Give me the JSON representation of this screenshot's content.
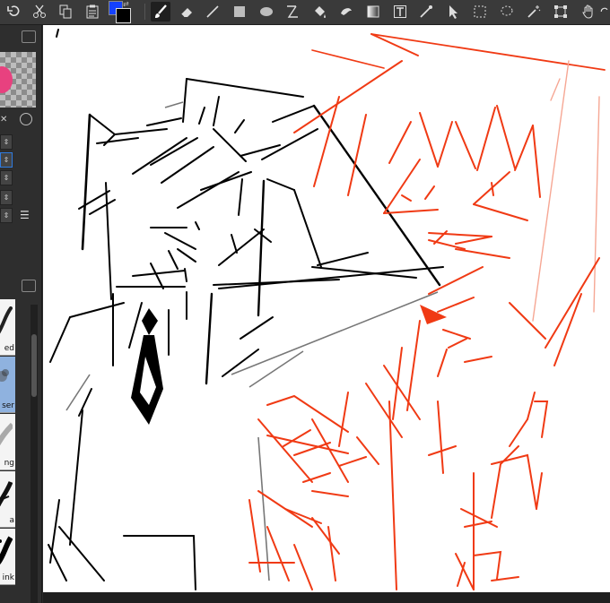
{
  "toolbar": {
    "tools": [
      {
        "id": "undo",
        "icon": "undo-icon"
      },
      {
        "id": "cut",
        "icon": "cut-icon"
      },
      {
        "id": "copy",
        "icon": "copy-icon"
      },
      {
        "id": "paste",
        "icon": "paste-icon"
      },
      {
        "id": "colors",
        "icon": "color-chips-icon",
        "foreground": "#1441ff",
        "background": "#000000"
      },
      {
        "id": "brush",
        "icon": "brush-icon",
        "selected": true
      },
      {
        "id": "eraser",
        "icon": "eraser-icon"
      },
      {
        "id": "line",
        "icon": "line-icon"
      },
      {
        "id": "rectangle",
        "icon": "rectangle-icon"
      },
      {
        "id": "ellipse",
        "icon": "ellipse-icon"
      },
      {
        "id": "curve",
        "icon": "curve-icon"
      },
      {
        "id": "fill",
        "icon": "bucket-icon"
      },
      {
        "id": "blend",
        "icon": "blend-icon"
      },
      {
        "id": "gradient",
        "icon": "gradient-icon"
      },
      {
        "id": "text",
        "icon": "text-icon"
      },
      {
        "id": "eyedropper",
        "icon": "eyedropper-icon"
      },
      {
        "id": "select-layer",
        "icon": "arrow-icon"
      },
      {
        "id": "rect-select",
        "icon": "rect-select-icon"
      },
      {
        "id": "lasso",
        "icon": "lasso-icon"
      },
      {
        "id": "magic-wand",
        "icon": "magic-wand-icon"
      },
      {
        "id": "transform",
        "icon": "transform-icon"
      },
      {
        "id": "hand",
        "icon": "hand-icon"
      },
      {
        "id": "rotate",
        "icon": "rotate-icon"
      }
    ]
  },
  "left_panel": {
    "brushes": [
      {
        "label": "ed",
        "selected": false
      },
      {
        "label": "ser",
        "selected": true
      },
      {
        "label": "ng",
        "selected": false
      },
      {
        "label": "a",
        "selected": false
      },
      {
        "label": "ink",
        "selected": false
      }
    ],
    "accent": "#2f7be0",
    "swatch": "#e8417f"
  },
  "canvas": {
    "background": "#ffffff",
    "ink_colors": {
      "black": "#000000",
      "red": "#f03a14"
    }
  }
}
